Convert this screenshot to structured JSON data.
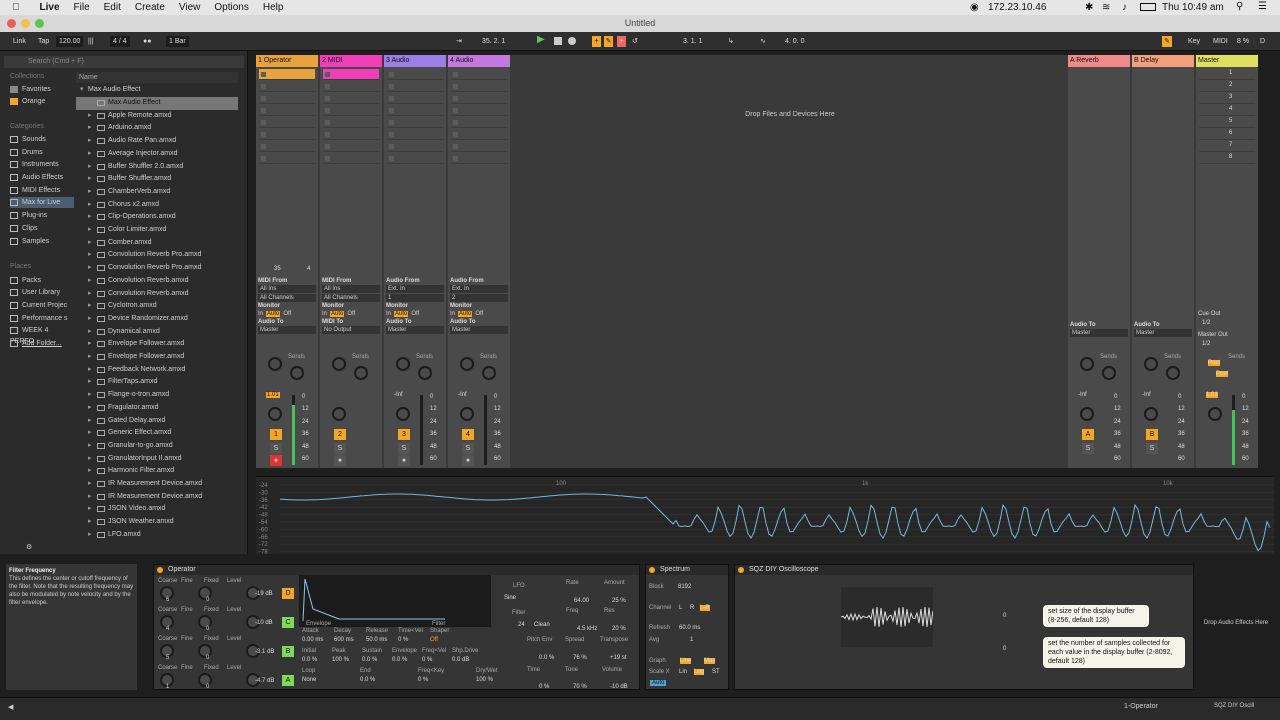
{
  "menubar": {
    "app": "Live",
    "items": [
      "File",
      "Edit",
      "Create",
      "View",
      "Options",
      "Help"
    ],
    "ip": "172.23.10.46",
    "clock": "Thu 10:49 am"
  },
  "window": {
    "title": "Untitled"
  },
  "transport": {
    "link": "Link",
    "tap": "Tap",
    "tempo": "120.00",
    "signature": "4 / 4",
    "quant": "1 Bar",
    "position": "35. 2. 1",
    "loop_start": "3. 1. 1",
    "loop_len": "4. 0. 0",
    "key": "Key",
    "midi": "MIDI",
    "cpu": "8 %",
    "disk": "D"
  },
  "browser": {
    "search_placeholder": "Search (Cmd + F)",
    "collections_label": "Collections",
    "collections": [
      "Favorites",
      "Orange"
    ],
    "categories_label": "Categories",
    "categories": [
      "Sounds",
      "Drums",
      "Instruments",
      "Audio Effects",
      "MIDI Effects",
      "Max for Live",
      "Plug-ins",
      "Clips",
      "Samples"
    ],
    "places_label": "Places",
    "places": [
      "Packs",
      "User Library",
      "Current Projec",
      "Performance s",
      "WEEK 4 PERFO",
      "Add Folder..."
    ],
    "name_header": "Name",
    "folder": "Max Audio Effect",
    "files": [
      "Max Audio Effect",
      "Apple Remote.amxd",
      "Arduino.amxd",
      "Audio Rate Pan.amxd",
      "Average Injector.amxd",
      "Buffer Shuffler 2.0.amxd",
      "Buffer Shuffler.amxd",
      "ChamberVerb.amxd",
      "Chorus x2.amxd",
      "Clip-Operations.amxd",
      "Color Limiter.amxd",
      "Comber.amxd",
      "Convolution Reverb Pro.amxd",
      "Convolution Reverb Pro.amxd",
      "Convolution Reverb.amxd",
      "Convolution Reverb.amxd",
      "Cyclotron.amxd",
      "Device Randomizer.amxd",
      "Dynamical.amxd",
      "Envelope Follower.amxd",
      "Envelope Follower.amxd",
      "Feedback Network.amxd",
      "FilterTaps.amxd",
      "Flange-o-tron.amxd",
      "Fragulator.amxd",
      "Gated Delay.amxd",
      "Generic Effect.amxd",
      "Granular-to-go.amxd",
      "GranulatorInput II.amxd",
      "Harmonic Filter.amxd",
      "IR Measurement Device.amxd",
      "IR Measurement Device.amxd",
      "JSON Video.amxd",
      "JSON Weather.amxd",
      "LFO.amxd"
    ]
  },
  "tracks": [
    {
      "name": "1 Operator",
      "color": "#e8a33c",
      "in1": "MIDI From",
      "in2": "All Ins",
      "in3": "All Channels",
      "mon": "Monitor",
      "to": "Audio To",
      "dest": "Master",
      "vol": "1.01",
      "num": "1"
    },
    {
      "name": "2 MIDI",
      "color": "#ee3fb8",
      "in1": "MIDI From",
      "in2": "All Ins",
      "in3": "All Channels",
      "mon": "Monitor",
      "to": "MIDI To",
      "dest": "No Output",
      "vol": "",
      "num": "2"
    },
    {
      "name": "3 Audio",
      "color": "#9b7fe6",
      "in1": "Audio From",
      "in2": "Ext. In",
      "in3": "1",
      "mon": "Monitor",
      "to": "Audio To",
      "dest": "Master",
      "vol": "-Inf",
      "num": "3"
    },
    {
      "name": "4 Audio",
      "color": "#c378e0",
      "in1": "Audio From",
      "in2": "Ext. In",
      "in3": "2",
      "mon": "Monitor",
      "to": "Audio To",
      "dest": "Master",
      "vol": "-Inf",
      "num": "4"
    }
  ],
  "monitor_opts": {
    "in": "In",
    "auto": "Auto",
    "off": "Off"
  },
  "sends_label": "Sends",
  "meter_scale": [
    "0",
    "12",
    "24",
    "36",
    "48",
    "60"
  ],
  "dropzone": "Drop Files and Devices Here",
  "returns": [
    {
      "name": "A Reverb",
      "color": "#f08a8a",
      "to": "Audio To",
      "dest": "Master",
      "vol": "-Inf",
      "letter": "A"
    },
    {
      "name": "B Delay",
      "color": "#f0a07a",
      "to": "Audio To",
      "dest": "Master",
      "vol": "-Inf",
      "letter": "B"
    }
  ],
  "master": {
    "name": "Master",
    "color": "#e0e060",
    "cue": "Cue Out",
    "cue_val": "1/2",
    "out": "Master Out",
    "out_val": "1/2",
    "vol": "1.01",
    "post": "Post"
  },
  "scenes": [
    "1",
    "2",
    "3",
    "4",
    "5",
    "6",
    "7",
    "8"
  ],
  "clip_count": "35",
  "clip_count2": "4",
  "spectrum": {
    "yticks": [
      "-24",
      "-30",
      "-36",
      "-42",
      "-48",
      "-54",
      "-60",
      "-66",
      "-72",
      "-78"
    ],
    "xticks": [
      "100",
      "1k",
      "10k"
    ]
  },
  "info": {
    "title": "Filter Frequency",
    "body": "This defines the center or cutoff frequency of the filter. Note that the resulting frequency may also be modulated by note velocity and by the filter envelope."
  },
  "operator": {
    "name": "Operator",
    "osc_labels": [
      "Coarse",
      "Fine",
      "Fixed",
      "Level"
    ],
    "osc": [
      {
        "coarse": "6",
        "fine": "0",
        "level": "-19 dB",
        "letter": "D"
      },
      {
        "coarse": "4",
        "fine": "0",
        "level": "-10 dB",
        "letter": "C"
      },
      {
        "coarse": "5",
        "fine": "0",
        "level": "-3.1 dB",
        "letter": "B"
      },
      {
        "coarse": "1",
        "fine": "0",
        "level": "-4.7 dB",
        "letter": "A"
      }
    ],
    "env_tab": "Envelope",
    "filter_tab": "Filter",
    "params1": [
      "Attack",
      "Decay",
      "Release",
      "Time<Vel",
      "Shaper"
    ],
    "vals1": [
      "0.00 ms",
      "600 ms",
      "50.0 ms",
      "0 %",
      "Off"
    ],
    "params2": [
      "Initial",
      "Peak",
      "Sustain",
      "Envelope",
      "Freq<Vel",
      "Shp.Drive"
    ],
    "vals2": [
      "0.0 %",
      "100 %",
      "0.0 %",
      "0.0 %",
      "0 %",
      "0.0 dB"
    ],
    "params3": [
      "Loop",
      "End",
      "Freq<Key",
      "Dry/Wet"
    ],
    "vals3": [
      "None",
      "0.0 %",
      "0 %",
      "100 %"
    ],
    "lfo": "LFO",
    "lfo_wave": "Sine",
    "rate_label": "Rate",
    "rate": "64.00",
    "amount_label": "Amount",
    "amount": "25 %",
    "filter_label": "Filter",
    "filter_type": "24",
    "filter_mode": "Clean",
    "freq_label": "Freq",
    "freq": "4.5 kHz",
    "res_label": "Res",
    "res": "20 %",
    "pitchenv_label": "Pitch Env",
    "pitchenv": "0.0 %",
    "spread_label": "Spread",
    "spread": "76 %",
    "transpose_label": "Transpose",
    "transpose": "+19 st",
    "time_label": "Time",
    "time": "0 %",
    "tone_label": "Tone",
    "tone": "70 %",
    "volume_label": "Volume",
    "volume": "-10 dB"
  },
  "spectrum_dev": {
    "name": "Spectrum",
    "block_label": "Block",
    "block": "8192",
    "channel_label": "Channel",
    "channel_opts": [
      "L",
      "R",
      "L-R"
    ],
    "refresh_label": "Refresh",
    "refresh": "60.0 ms",
    "avg_label": "Avg",
    "avg": "1",
    "graph_label": "Graph",
    "graph_opts": [
      "Line",
      "Max"
    ],
    "scalex_label": "Scale X",
    "scalex_opts": [
      "Lin",
      "Log",
      "ST"
    ],
    "auto": "Auto"
  },
  "oscilloscope": {
    "name": "SQZ DIY Oscilloscope",
    "val1": "0",
    "val2": "0",
    "tip1": "set size of the display buffer (8-256, default 128)",
    "tip2": "set the number of samples collected for each value in the display buffer (2-8092, default 128)"
  },
  "drop_fx": "Drop Audio Effects Here",
  "status": {
    "track": "1-Operator",
    "device": "SQZ DIY Oscill"
  }
}
